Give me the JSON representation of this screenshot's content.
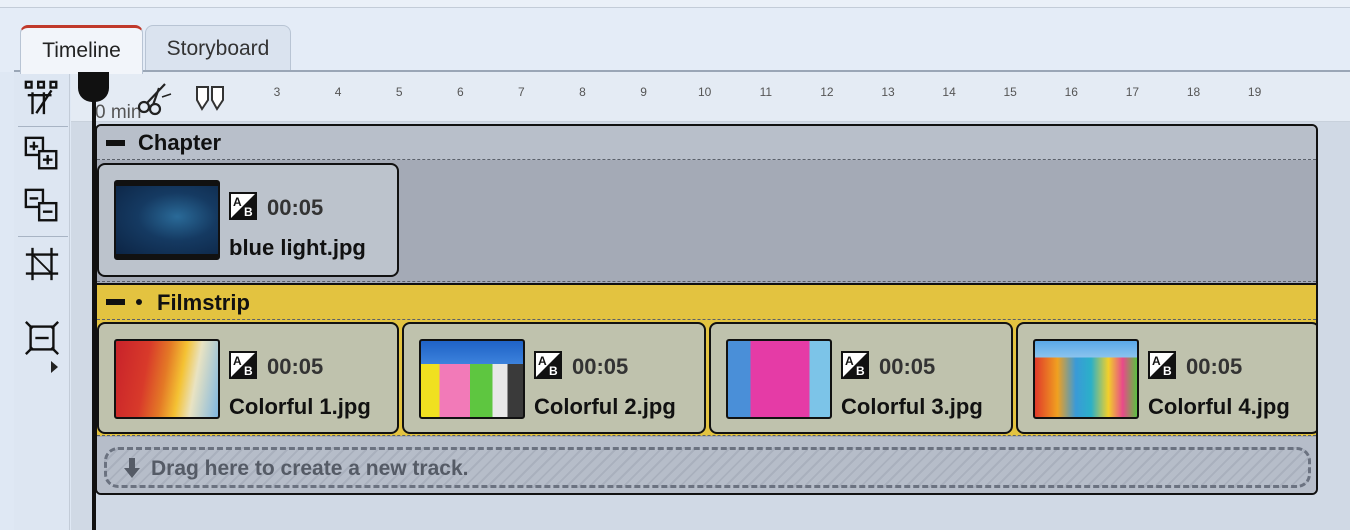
{
  "tabs": [
    {
      "label": "Timeline",
      "active": true
    },
    {
      "label": "Storyboard",
      "active": false
    }
  ],
  "toolbar": {
    "tools": [
      {
        "name": "split-tracks-icon"
      },
      {
        "name": "add-track-icon"
      },
      {
        "name": "remove-track-icon"
      },
      {
        "name": "fit-width-icon"
      },
      {
        "name": "fit-all-icon"
      }
    ]
  },
  "ruler": {
    "zero_label": "0 min",
    "ticks": [
      "3",
      "4",
      "5",
      "6",
      "7",
      "8",
      "9",
      "10",
      "11",
      "12",
      "13",
      "14",
      "15",
      "16",
      "17",
      "18",
      "19"
    ]
  },
  "tracks": {
    "chapter": {
      "title": "Chapter",
      "clips": [
        {
          "duration": "00:05",
          "name": "blue light.jpg"
        }
      ]
    },
    "filmstrip": {
      "title": "Filmstrip",
      "clips": [
        {
          "duration": "00:05",
          "name": "Colorful 1.jpg"
        },
        {
          "duration": "00:05",
          "name": "Colorful 2.jpg"
        },
        {
          "duration": "00:05",
          "name": "Colorful 3.jpg"
        },
        {
          "duration": "00:05",
          "name": "Colorful 4.jpg"
        }
      ]
    },
    "drop_text": "Drag here to create a new track."
  },
  "colors": {
    "chapter_header": "#b8bfca",
    "filmstrip_header": "#e3c340",
    "active_tab_accent": "#c0392b"
  }
}
